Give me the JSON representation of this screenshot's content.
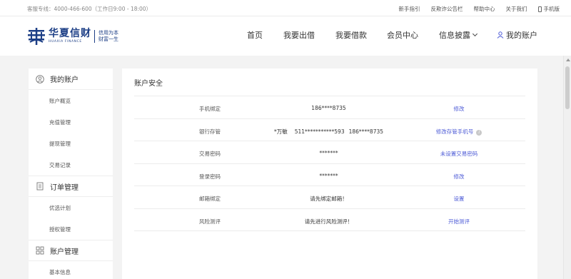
{
  "topbar": {
    "hotline": "客服专线：4000-466-600（工作日9:00 - 18:00）",
    "links": [
      "新手指引",
      "反欺诈公告栏",
      "帮助中心",
      "关于我们"
    ],
    "mobile": "手机版"
  },
  "logo": {
    "cn": "华夏信财",
    "en": "HUAXIA FINANCE",
    "slogan_line1": "信用为本",
    "slogan_line2": "财富一生"
  },
  "nav": {
    "home": "首页",
    "lend": "我要出借",
    "borrow": "我要借款",
    "member": "会员中心",
    "disclosure": "信息披露",
    "account": "我的账户"
  },
  "sidebar": {
    "my_account": {
      "title": "我的账户",
      "items": [
        "账户概览",
        "充值管理",
        "提现管理",
        "交易记录"
      ]
    },
    "orders": {
      "title": "订单管理",
      "items": [
        "优选计划",
        "授权管理"
      ]
    },
    "account_mgmt": {
      "title": "账户管理",
      "items": [
        "基本信息"
      ]
    }
  },
  "main": {
    "title": "账户安全",
    "rows": [
      {
        "label": "手机绑定",
        "value": "186****8735",
        "action": "修改"
      },
      {
        "label": "银行存管",
        "value_name": "*万敏",
        "value_card": "511***********593",
        "value_phone": "186****8735",
        "action": "修改存管手机号"
      },
      {
        "label": "交易密码",
        "value": "*******",
        "action": "未设置交易密码"
      },
      {
        "label": "登录密码",
        "value": "*******",
        "action": "修改"
      },
      {
        "label": "邮箱绑定",
        "value": "请先绑定邮箱！",
        "action": "设置"
      },
      {
        "label": "风险测评",
        "value": "请先进行风险测评！",
        "action": "开始测评"
      }
    ]
  },
  "icons": {
    "info": "i"
  },
  "colors": {
    "brand": "#1d3f86",
    "link": "#4c5ad6"
  }
}
